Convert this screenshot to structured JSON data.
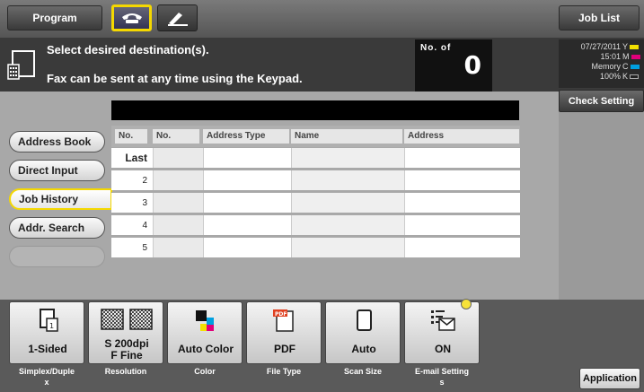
{
  "topbar": {
    "program_label": "Program",
    "joblist_label": "Job List",
    "fax_icon": "fax-handset-icon",
    "scan_icon": "scan-pen-icon"
  },
  "message": {
    "line1": "Select desired destination(s).",
    "line2": "Fax can be sent at any time using the Keypad.",
    "icon": "keypad-document-icon"
  },
  "destinations": {
    "label": "No. of",
    "count": "0"
  },
  "status": {
    "date": "07/27/2011",
    "time": "15:01",
    "memory_label": "Memory",
    "memory_value": "100%",
    "toner": [
      {
        "letter": "Y",
        "color": "#f2e000"
      },
      {
        "letter": "M",
        "color": "#e0007a"
      },
      {
        "letter": "C",
        "color": "#00a0e0"
      },
      {
        "letter": "K",
        "color": "#222222"
      }
    ],
    "check_setting_label": "Check Setting"
  },
  "sidebar": {
    "tabs": [
      {
        "label": "Address Book"
      },
      {
        "label": "Direct Input"
      },
      {
        "label": "Job History"
      },
      {
        "label": "Addr. Search"
      }
    ],
    "active": "Job History"
  },
  "table": {
    "headers": [
      "No.",
      "No.",
      "Address Type",
      "Name",
      "Address"
    ],
    "rows": [
      {
        "no": "Last"
      },
      {
        "no": "2"
      },
      {
        "no": "3"
      },
      {
        "no": "4"
      },
      {
        "no": "5"
      }
    ]
  },
  "settings": [
    {
      "value_line1": "1-Sided",
      "value_line2": "",
      "caption_line1": "Simplex/Duple",
      "caption_line2": "x",
      "icon": "one-sided-page-icon"
    },
    {
      "value_line1": "S 200dpi",
      "value_line2": "F Fine",
      "caption_line1": "Resolution",
      "caption_line2": "",
      "icon": "resolution-grid-icon"
    },
    {
      "value_line1": "Auto Color",
      "value_line2": "",
      "caption_line1": "Color",
      "caption_line2": "",
      "icon": "color-squares-icon"
    },
    {
      "value_line1": "PDF",
      "value_line2": "",
      "caption_line1": "File Type",
      "caption_line2": "",
      "icon": "pdf-file-icon"
    },
    {
      "value_line1": "Auto",
      "value_line2": "",
      "caption_line1": "Scan Size",
      "caption_line2": "",
      "icon": "page-size-icon"
    },
    {
      "value_line1": "ON",
      "value_line2": "",
      "caption_line1": "E-mail Setting",
      "caption_line2": "s",
      "icon": "email-envelope-icon"
    }
  ],
  "application_label": "Application"
}
